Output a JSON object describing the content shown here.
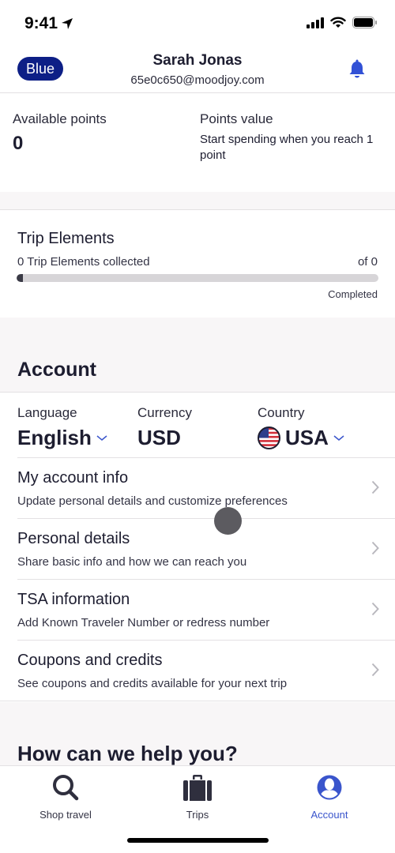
{
  "status_bar": {
    "time": "9:41",
    "icons": [
      "location-arrow-icon",
      "cellular-signal-icon",
      "wifi-icon",
      "battery-icon"
    ]
  },
  "header": {
    "tier_badge": "Blue",
    "name": "Sarah Jonas",
    "email": "65e0c650@moodjoy.com",
    "notification_icon": "bell-icon"
  },
  "points": {
    "available_label": "Available points",
    "available_value": "0",
    "value_label": "Points value",
    "value_description": "Start spending when you reach 1 point"
  },
  "trip_elements": {
    "title": "Trip Elements",
    "collected_text": "0 Trip Elements collected",
    "of_text": "of 0",
    "progress_fraction": 0,
    "completed_label": "Completed"
  },
  "account": {
    "title": "Account",
    "preferences": [
      {
        "label": "Language",
        "value": "English",
        "has_dropdown": true
      },
      {
        "label": "Currency",
        "value": "USD",
        "has_dropdown": false
      },
      {
        "label": "Country",
        "value": "USA",
        "has_dropdown": true,
        "flag": "us-flag-icon"
      }
    ],
    "menu_items": [
      {
        "title": "My account info",
        "subtitle": "Update personal details and customize preferences"
      },
      {
        "title": "Personal details",
        "subtitle": "Share basic info and how we can reach you"
      },
      {
        "title": "TSA information",
        "subtitle": "Add Known Traveler Number or redress number"
      },
      {
        "title": "Coupons and credits",
        "subtitle": "See coupons and credits available for your next trip"
      }
    ]
  },
  "help": {
    "title": "How can we help you?"
  },
  "tabbar": {
    "tabs": [
      {
        "label": "Shop travel",
        "icon": "search-icon",
        "active": false
      },
      {
        "label": "Trips",
        "icon": "suitcase-icon",
        "active": false
      },
      {
        "label": "Account",
        "icon": "account-icon",
        "active": true
      }
    ]
  },
  "colors": {
    "brand_navy": "#0d1f86",
    "accent_blue": "#3a55cc",
    "text_dark": "#1d1d30",
    "section_gray": "#f8f6f7"
  }
}
